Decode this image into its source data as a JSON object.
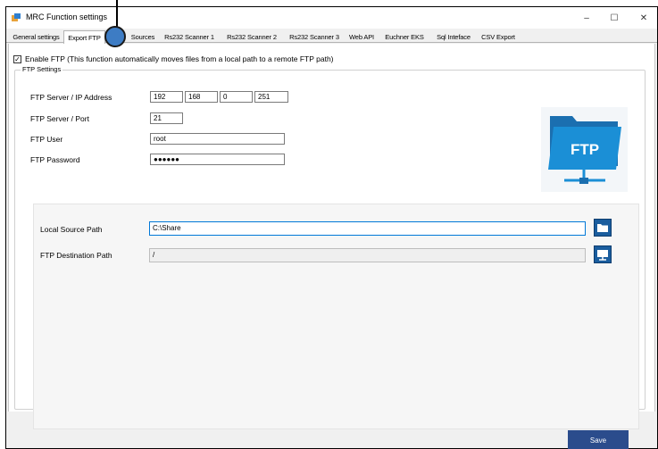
{
  "window": {
    "title": "MRC Function settings",
    "controls": {
      "minimize": "–",
      "maximize": "☐",
      "close": "✕"
    }
  },
  "tabs": [
    {
      "label": "General settings",
      "active": false
    },
    {
      "label": "Export FTP",
      "active": true
    },
    {
      "label": "Sources",
      "active": false
    },
    {
      "label": "Rs232 Scanner 1",
      "active": false
    },
    {
      "label": "Rs232 Scanner 2",
      "active": false
    },
    {
      "label": "Rs232 Scanner 3",
      "active": false
    },
    {
      "label": "Web API",
      "active": false
    },
    {
      "label": "Euchner EKS",
      "active": false
    },
    {
      "label": "Sql Inteface",
      "active": false
    },
    {
      "label": "CSV Export",
      "active": false
    }
  ],
  "enable_ftp": {
    "checked": true,
    "check_glyph": "✓",
    "label": "Enable FTP (This function automatically moves files from a local path to a remote FTP path)"
  },
  "ftp_settings": {
    "legend": "FTP Settings",
    "server_label": "FTP Server / IP Address",
    "ip": [
      "192",
      "168",
      "0",
      "251"
    ],
    "port_label": "FTP Server / Port",
    "port": "21",
    "user_label": "FTP User",
    "user": "root",
    "password_label": "FTP Password",
    "password": "●●●●●●",
    "logo_text": "FTP"
  },
  "paths": {
    "local_label": "Local Source Path",
    "local_value": "C:\\Share",
    "dest_label": "FTP Destination Path",
    "dest_value": "/"
  },
  "save_label": "Save",
  "colors": {
    "accent": "#2b4c8c",
    "folder_blue": "#1a5d9e",
    "logo_blue": "#1b8fd6",
    "callout": "#3d7cc4"
  }
}
